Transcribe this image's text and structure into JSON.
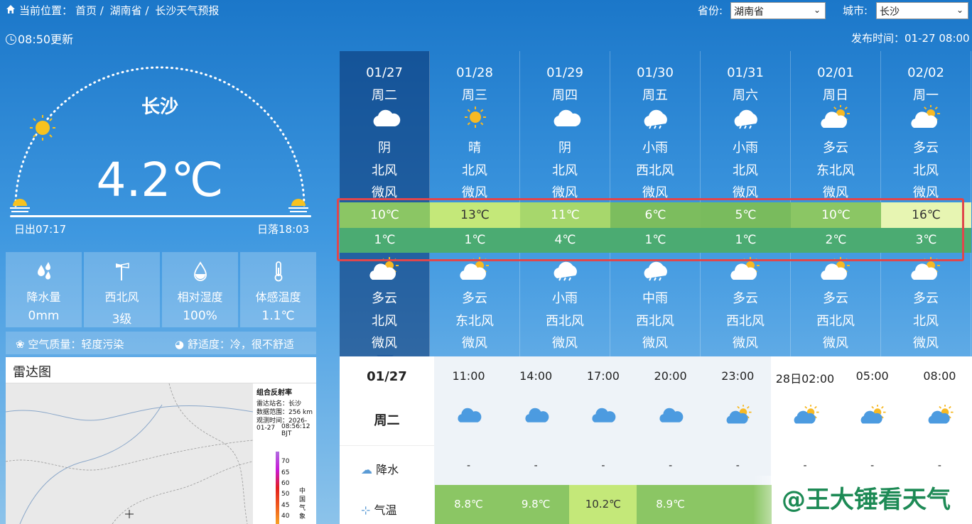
{
  "breadcrumb": {
    "prefix": "当前位置：",
    "items": [
      "首页 /",
      "湖南省 /",
      "长沙天气预报"
    ]
  },
  "selectors": {
    "province_label": "省份:",
    "province_value": "湖南省",
    "city_label": "城市:",
    "city_value": "长沙"
  },
  "updated": "08:50更新",
  "publish_time": "发布时间：01-27 08:00",
  "current": {
    "city": "长沙",
    "temperature": "4.2℃",
    "sunrise": "日出07:17",
    "sunset": "日落18:03"
  },
  "stats": [
    {
      "icon": "raindrop-icon",
      "label": "降水量",
      "value": "0mm"
    },
    {
      "icon": "windsock-icon",
      "label": "西北风",
      "value": "3级"
    },
    {
      "icon": "humidity-icon",
      "label": "相对湿度",
      "value": "100%"
    },
    {
      "icon": "thermometer-icon",
      "label": "体感温度",
      "value": "1.1℃"
    }
  ],
  "air": {
    "quality": "空气质量：轻度污染",
    "comfort": "舒适度：冷，很不舒适"
  },
  "radar": {
    "title": "雷达图",
    "legend_title": "组合反射率",
    "station": "雷达站名：长沙",
    "range": "数据范围：256 km",
    "obs_label": "观测时间：2026-01-27",
    "obs_time": "08:56:12 BJT",
    "scale": [
      "70",
      "65",
      "60",
      "50",
      "45",
      "40"
    ],
    "org": "中国气象"
  },
  "days": [
    {
      "date": "01/27",
      "week": "周二",
      "day_weather": "阴",
      "day_wind_dir": "北风",
      "day_wind": "微风",
      "high": "10℃",
      "low": "1℃",
      "night_weather": "多云",
      "night_wind_dir": "北风",
      "night_wind": "微风",
      "day_icon": "cloud-icon",
      "night_icon": "partly-cloudy-icon",
      "high_color": "#8bc664"
    },
    {
      "date": "01/28",
      "week": "周三",
      "day_weather": "晴",
      "day_wind_dir": "北风",
      "day_wind": "微风",
      "high": "13℃",
      "low": "1℃",
      "night_weather": "多云",
      "night_wind_dir": "东北风",
      "night_wind": "微风",
      "day_icon": "sun-icon",
      "night_icon": "partly-cloudy-icon",
      "high_color": "#c4e879"
    },
    {
      "date": "01/29",
      "week": "周四",
      "day_weather": "阴",
      "day_wind_dir": "北风",
      "day_wind": "微风",
      "high": "11℃",
      "low": "4℃",
      "night_weather": "小雨",
      "night_wind_dir": "西北风",
      "night_wind": "微风",
      "day_icon": "cloud-icon",
      "night_icon": "rain-icon",
      "high_color": "#a7d76c"
    },
    {
      "date": "01/30",
      "week": "周五",
      "day_weather": "小雨",
      "day_wind_dir": "西北风",
      "day_wind": "微风",
      "high": "6℃",
      "low": "1℃",
      "night_weather": "中雨",
      "night_wind_dir": "西北风",
      "night_wind": "微风",
      "day_icon": "rain-icon",
      "night_icon": "rain-icon",
      "high_color": "#7cbd5e"
    },
    {
      "date": "01/31",
      "week": "周六",
      "day_weather": "小雨",
      "day_wind_dir": "北风",
      "day_wind": "微风",
      "high": "5℃",
      "low": "1℃",
      "night_weather": "多云",
      "night_wind_dir": "西北风",
      "night_wind": "微风",
      "day_icon": "rain-icon",
      "night_icon": "partly-cloudy-icon",
      "high_color": "#79bb5d"
    },
    {
      "date": "02/01",
      "week": "周日",
      "day_weather": "多云",
      "day_wind_dir": "东北风",
      "day_wind": "微风",
      "high": "10℃",
      "low": "2℃",
      "night_weather": "多云",
      "night_wind_dir": "西北风",
      "night_wind": "微风",
      "day_icon": "partly-cloudy-icon",
      "night_icon": "partly-cloudy-icon",
      "high_color": "#8bc664"
    },
    {
      "date": "02/02",
      "week": "周一",
      "day_weather": "多云",
      "day_wind_dir": "北风",
      "day_wind": "微风",
      "high": "16℃",
      "low": "3℃",
      "night_weather": "多云",
      "night_wind_dir": "北风",
      "night_wind": "微风",
      "day_icon": "partly-cloudy-icon",
      "night_icon": "partly-cloudy-icon",
      "high_color": "#e7f5b2"
    }
  ],
  "hourly": {
    "date": "01/27",
    "week": "周二",
    "precip_label": "降水",
    "temp_label": "气温",
    "hours": [
      {
        "time": "11:00",
        "icon": "cloud-icon",
        "precip": "-",
        "temp": "8.8℃",
        "color": "#8bc664"
      },
      {
        "time": "14:00",
        "icon": "cloud-icon",
        "precip": "-",
        "temp": "9.8℃",
        "color": "#8bc664"
      },
      {
        "time": "17:00",
        "icon": "cloud-icon",
        "precip": "-",
        "temp": "10.2℃",
        "color": "#c4e879"
      },
      {
        "time": "20:00",
        "icon": "cloud-icon",
        "precip": "-",
        "temp": "8.9℃",
        "color": "#8bc664"
      },
      {
        "time": "23:00",
        "icon": "partly-cloudy-icon",
        "precip": "-",
        "temp": "",
        "color": "#8bc664"
      },
      {
        "time": "28日02:00",
        "icon": "partly-cloudy-icon",
        "precip": "-",
        "temp": "",
        "color": "#ffffff"
      },
      {
        "time": "05:00",
        "icon": "partly-cloudy-icon",
        "precip": "-",
        "temp": "",
        "color": "#ffffff"
      },
      {
        "time": "08:00",
        "icon": "partly-cloudy-icon",
        "precip": "-",
        "temp": "",
        "color": "#ffffff"
      }
    ]
  },
  "watermark": "@王大锤看天气"
}
